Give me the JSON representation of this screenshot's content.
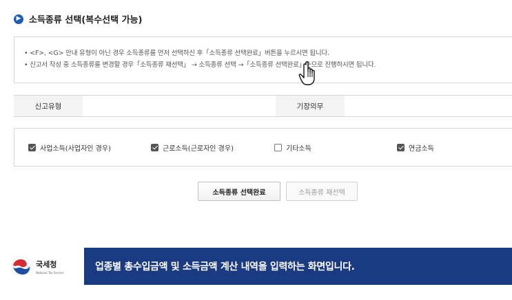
{
  "section": {
    "title": "소득종류 선택(복수선택 가능)"
  },
  "notice": {
    "lines": [
      "• <F>, <G> 안내 유형이 아닌 경우 소득종류를 먼저 선택하신 후「소득종류 선택완료」버튼을 누르시면 됩니다.",
      "• 신고서 작성 중 소득종류를 변경할 경우「소득종류 재선택」 → 소득종류 선택 →「소득종류 선택완료」순으로 진행하시면 됩니다."
    ]
  },
  "info": {
    "report_type_label": "신고유형",
    "report_type_value": "",
    "bookkeeping_label": "기장의무",
    "bookkeeping_value": ""
  },
  "income_types": [
    {
      "label": "사업소득(사업자인 경우)",
      "checked": true
    },
    {
      "label": "근로소득(근로자인 경우)",
      "checked": true
    },
    {
      "label": "기타소득",
      "checked": false
    },
    {
      "label": "연금소득",
      "checked": true
    }
  ],
  "buttons": {
    "complete_label": "소득종류 선택완료",
    "reselect_label": "소득종류 재선택"
  },
  "footer": {
    "agency_name": "국세청",
    "agency_en": "National Tax Service",
    "caption": "업종별 총수입금액 및 소득금액 계산 내역을 입력하는 화면입니다."
  },
  "colors": {
    "accent": "#1d5bb8",
    "banner": "#1a3b82",
    "logo_red": "#d62b34",
    "logo_blue": "#1d4ea3"
  }
}
